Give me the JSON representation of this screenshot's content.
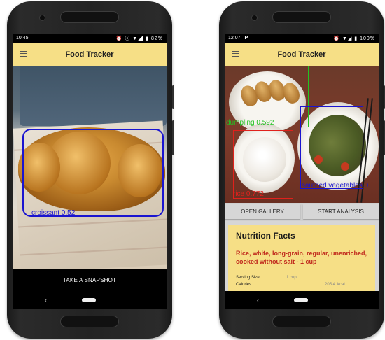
{
  "left": {
    "status_time": "10:45",
    "status_icons": "⏰ ⦿ ▼◢ ▮ 82%",
    "app_title": "Food Tracker",
    "detection": {
      "label": "croissant 0.52",
      "color": "#1a14d0"
    },
    "snapshot_label": "TAKE A SNAPSHOT",
    "nav_back": "‹"
  },
  "right": {
    "status_time": "12:07",
    "status_p": "P",
    "status_icons": "⏰ ▼◢ ▮ 100%",
    "app_title": "Food Tracker",
    "detections": [
      {
        "label": "dumpling 0.592",
        "color": "#22c322"
      },
      {
        "label": "rice 0.772",
        "color": "#e0211c"
      },
      {
        "label": "sauteed vegetables 0.",
        "color": "#1a14d0"
      }
    ],
    "buttons": {
      "gallery": "OPEN GALLERY",
      "analysis": "START ANALYSIS"
    },
    "nutrition": {
      "title": "Nutrition Facts",
      "food_name": "Rice, white, long-grain, regular, unenriched, cooked without salt - 1 cup",
      "rows": [
        {
          "label": "Serving Size",
          "value": "1 cup",
          "unit": ""
        },
        {
          "label": "Calories",
          "value": "205.4",
          "unit": "kcal"
        }
      ]
    },
    "nav_back": "‹"
  }
}
